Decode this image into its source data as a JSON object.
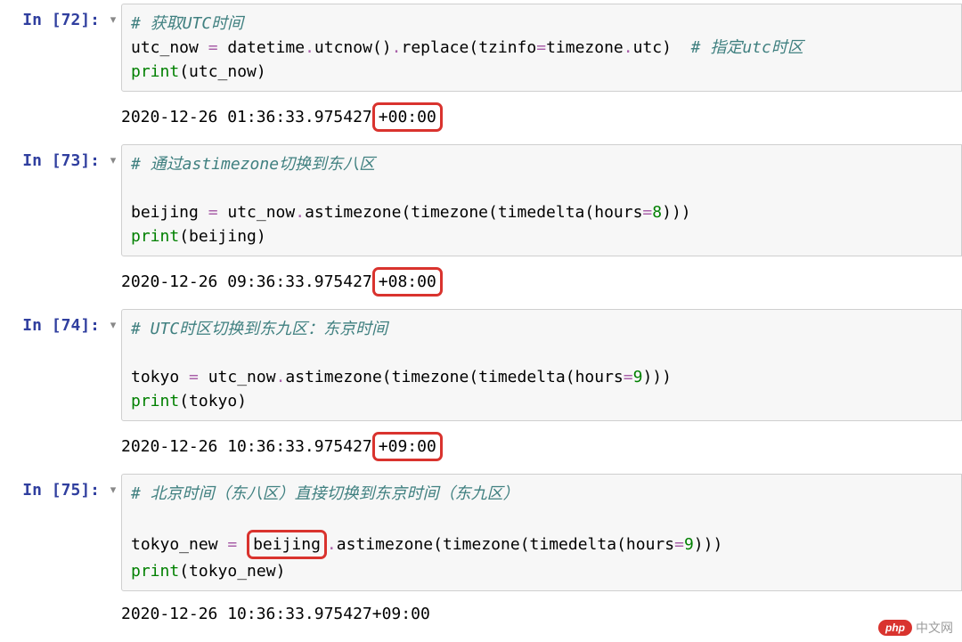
{
  "cells": [
    {
      "prompt_label": "In [",
      "prompt_num": "72",
      "prompt_suffix": "]:",
      "code": {
        "line1_comment": "# 获取UTC时间",
        "line2_var": "utc_now",
        "line2_eq": " = ",
        "line2_expr1": "datetime",
        "line2_dot1": ".",
        "line2_expr2": "utcnow",
        "line2_par1": "()",
        "line2_dot2": ".",
        "line2_expr3": "replace",
        "line2_par2": "(",
        "line2_kw": "tzinfo",
        "line2_eq2": "=",
        "line2_expr4": "timezone",
        "line2_dot3": ".",
        "line2_expr5": "utc",
        "line2_par3": ")",
        "line2_trail_space": "  ",
        "line2_comment": "# 指定utc时区",
        "line3_fn": "print",
        "line3_par1": "(",
        "line3_arg": "utc_now",
        "line3_par2": ")"
      },
      "output_before": "2020-12-26 01:36:33.975427",
      "output_hl": "+00:00",
      "output_after": ""
    },
    {
      "prompt_label": "In [",
      "prompt_num": "73",
      "prompt_suffix": "]:",
      "code": {
        "line1_comment": "# 通过astimezone切换到东八区",
        "line3_var": "beijing",
        "line3_eq": " = ",
        "line3_expr1": "utc_now",
        "line3_dot1": ".",
        "line3_expr2": "astimezone",
        "line3_par1": "(",
        "line3_expr3": "timezone",
        "line3_par2": "(",
        "line3_expr4": "timedelta",
        "line3_par3": "(",
        "line3_kw": "hours",
        "line3_eq2": "=",
        "line3_num": "8",
        "line3_par4": ")))",
        "line4_fn": "print",
        "line4_par1": "(",
        "line4_arg": "beijing",
        "line4_par2": ")"
      },
      "output_before": "2020-12-26 09:36:33.975427",
      "output_hl": "+08:00",
      "output_after": ""
    },
    {
      "prompt_label": "In [",
      "prompt_num": "74",
      "prompt_suffix": "]:",
      "code": {
        "line1_comment": "# UTC时区切换到东九区：东京时间",
        "line3_var": "tokyo",
        "line3_eq": " = ",
        "line3_expr1": "utc_now",
        "line3_dot1": ".",
        "line3_expr2": "astimezone",
        "line3_par1": "(",
        "line3_expr3": "timezone",
        "line3_par2": "(",
        "line3_expr4": "timedelta",
        "line3_par3": "(",
        "line3_kw": "hours",
        "line3_eq2": "=",
        "line3_num": "9",
        "line3_par4": ")))",
        "line4_fn": "print",
        "line4_par1": "(",
        "line4_arg": "tokyo",
        "line4_par2": ")"
      },
      "output_before": "2020-12-26 10:36:33.975427",
      "output_hl": "+09:00",
      "output_after": ""
    },
    {
      "prompt_label": "In [",
      "prompt_num": "75",
      "prompt_suffix": "]:",
      "code": {
        "line1_comment": "# 北京时间（东八区）直接切换到东京时间（东九区）",
        "line3_var": "tokyo_new",
        "line3_eq": " = ",
        "line3_hl": "beijing",
        "line3_dot1": ".",
        "line3_expr2": "astimezone",
        "line3_par1": "(",
        "line3_expr3": "timezone",
        "line3_par2": "(",
        "line3_expr4": "timedelta",
        "line3_par3": "(",
        "line3_kw": "hours",
        "line3_eq2": "=",
        "line3_num": "9",
        "line3_par4": ")))",
        "line4_fn": "print",
        "line4_par1": "(",
        "line4_arg": "tokyo_new",
        "line4_par2": ")"
      },
      "output_before": "2020-12-26 10:36:33.975427+09:00",
      "output_hl": "",
      "output_after": ""
    }
  ],
  "collapser_glyph": "▾",
  "watermark": {
    "pill": "php",
    "text": "中文网"
  }
}
